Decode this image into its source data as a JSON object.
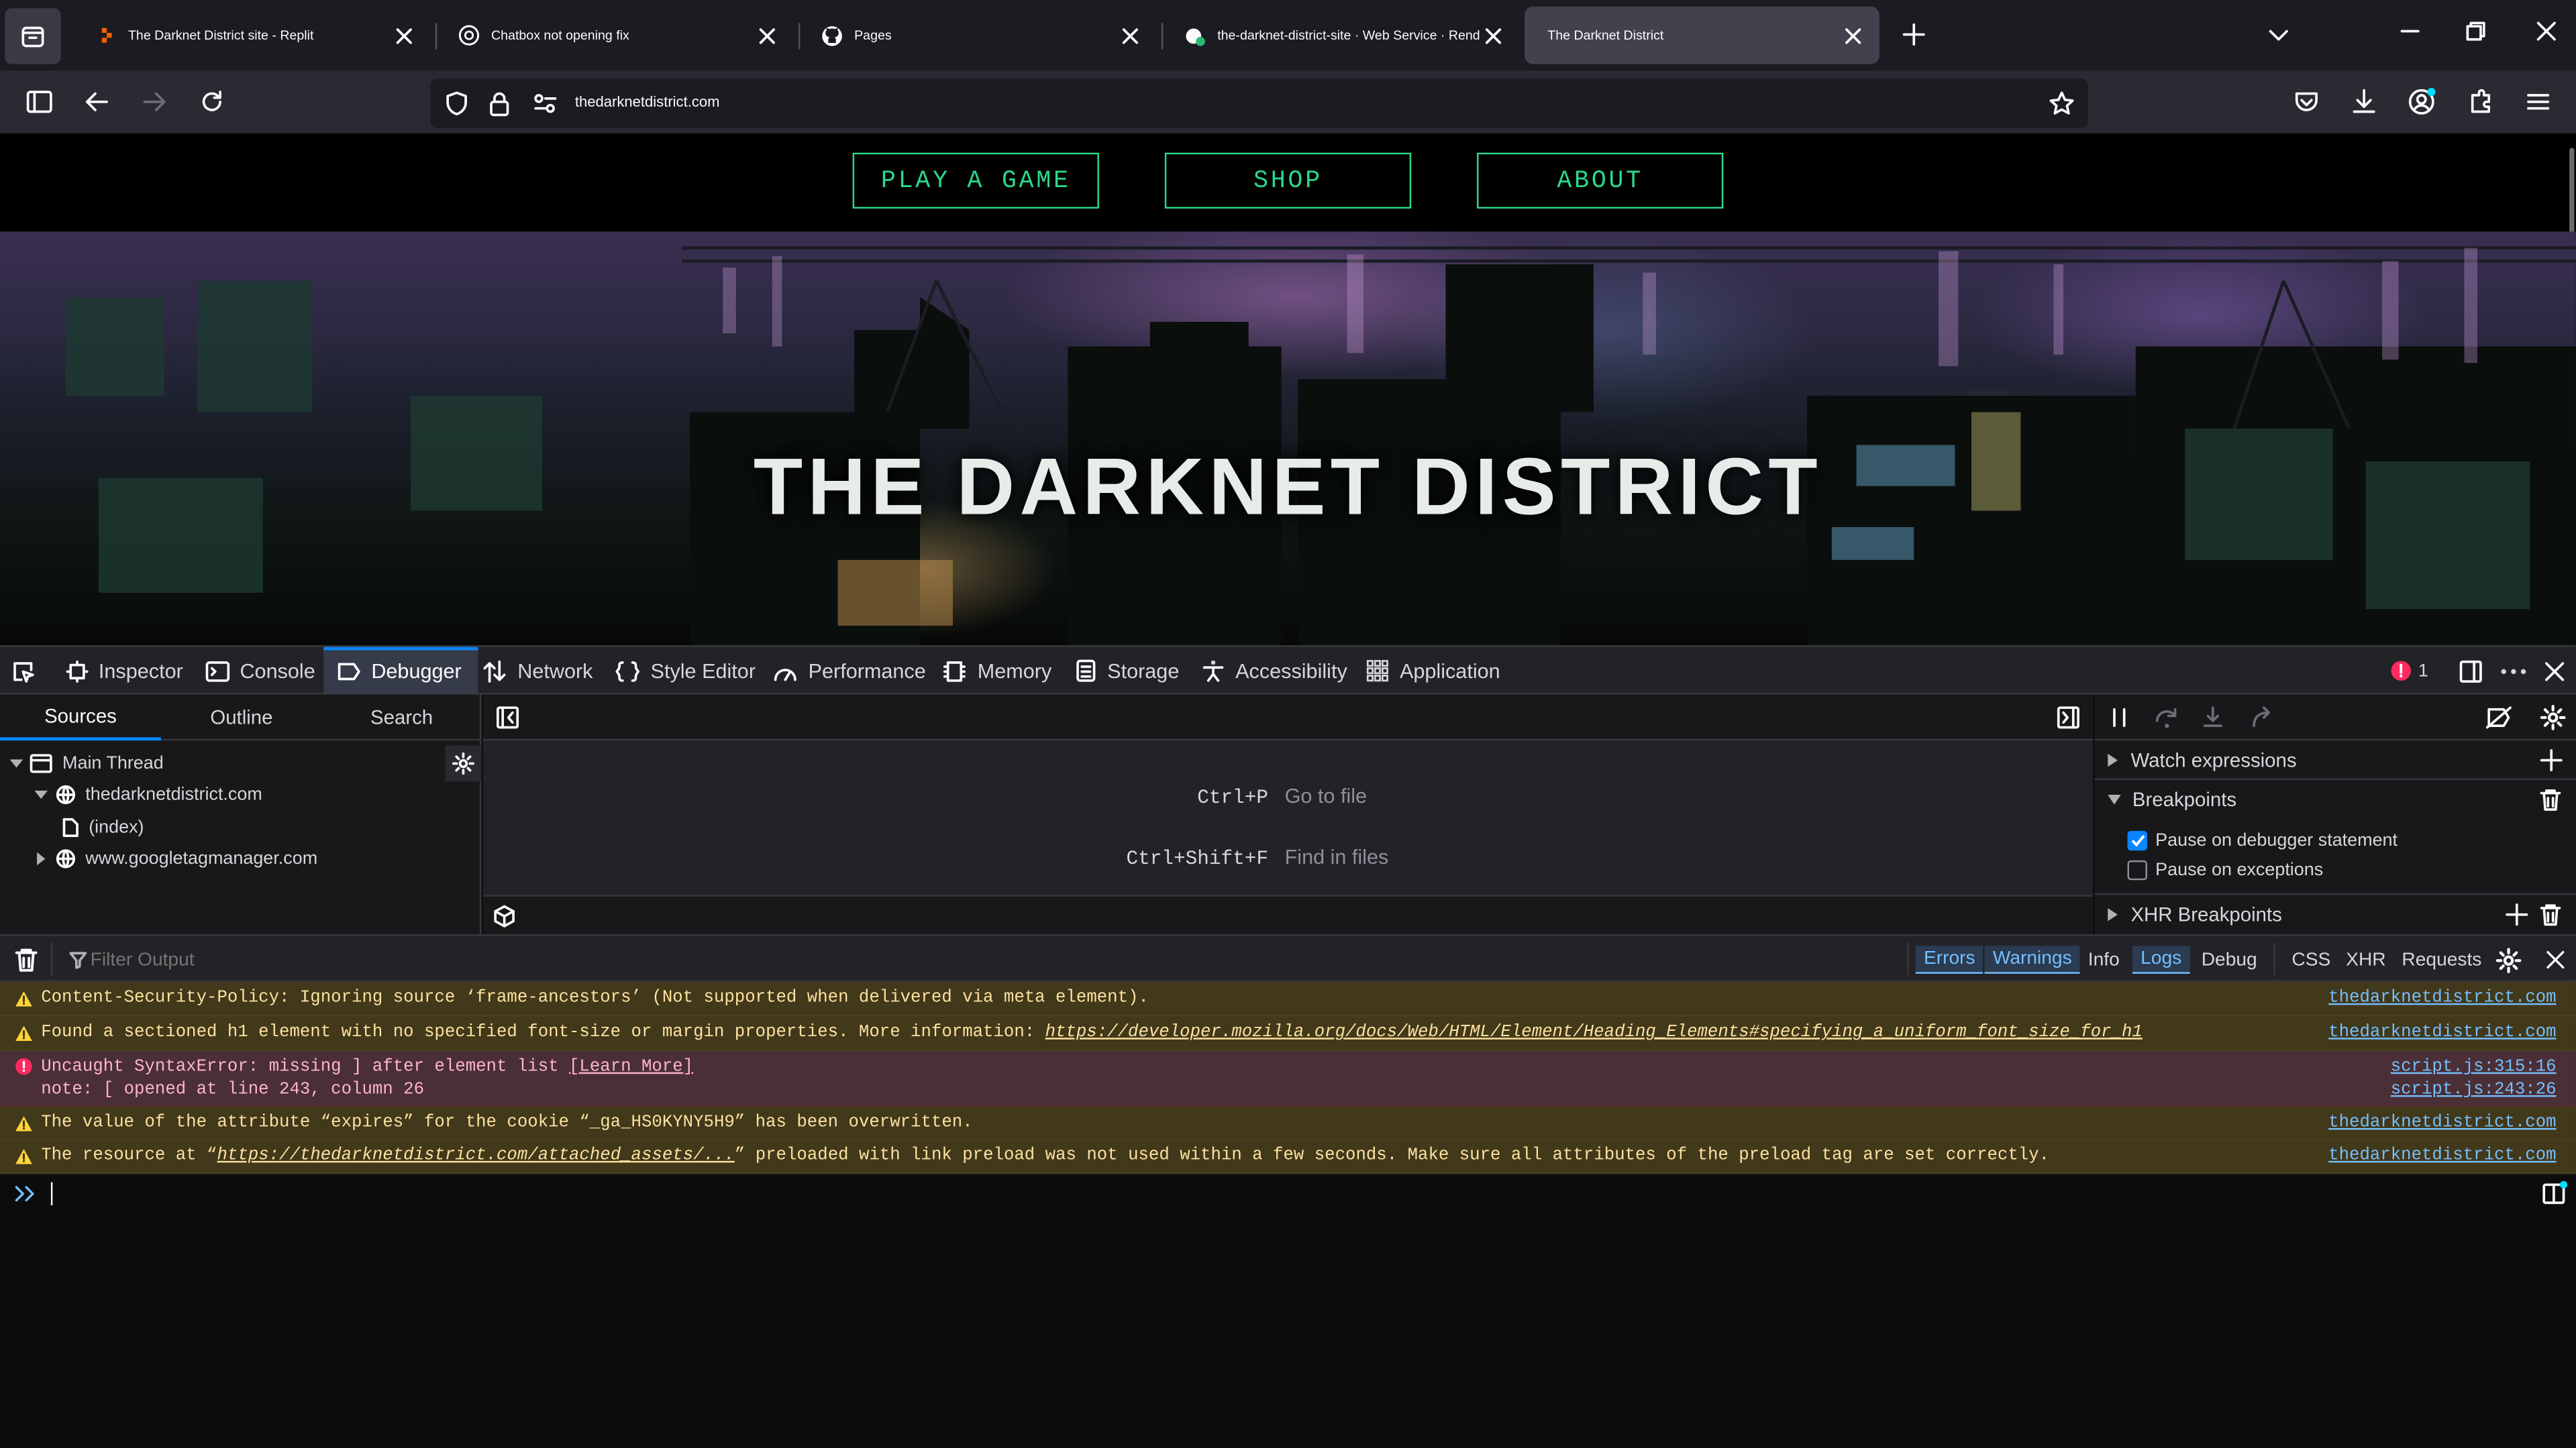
{
  "browser": {
    "tabs": [
      {
        "title": "The Darknet District site - Replit",
        "icon": "replit-icon"
      },
      {
        "title": "Chatbox not opening fix",
        "icon": "openai-icon"
      },
      {
        "title": "Pages",
        "icon": "github-icon"
      },
      {
        "title": "the-darknet-district-site · Web Service · Render",
        "icon": "render-icon"
      },
      {
        "title": "The Darknet District",
        "icon": "none",
        "active": true
      }
    ],
    "url": "thedarknetdistrict.com"
  },
  "page": {
    "nav": [
      "PLAY A GAME",
      "SHOP",
      "ABOUT"
    ],
    "hero_title": "THE DARKNET DISTRICT",
    "accent": "#2bd98a"
  },
  "devtools": {
    "tabs": [
      "Inspector",
      "Console",
      "Debugger",
      "Network",
      "Style Editor",
      "Performance",
      "Memory",
      "Storage",
      "Accessibility",
      "Application"
    ],
    "selected_tab": "Debugger",
    "error_count": "1",
    "sources_tabs": [
      "Sources",
      "Outline",
      "Search"
    ],
    "tree": [
      "Main Thread",
      "thedarknetdistrict.com",
      "(index)",
      "www.googletagmanager.com"
    ],
    "shortcuts": [
      {
        "keys": "Ctrl+P",
        "desc": "Go to file"
      },
      {
        "keys": "Ctrl+Shift+F",
        "desc": "Find in files"
      }
    ],
    "side": {
      "watch": "Watch expressions",
      "breakpoints": "Breakpoints",
      "pause_debugger": "Pause on debugger statement",
      "pause_exceptions": "Pause on exceptions",
      "xhr": "XHR Breakpoints"
    },
    "console": {
      "filter_placeholder": "Filter Output",
      "filters": [
        "Errors",
        "Warnings",
        "Info",
        "Logs",
        "Debug",
        "CSS",
        "XHR",
        "Requests"
      ],
      "messages": [
        {
          "level": "warn",
          "text": "Content-Security-Policy: Ignoring source ‘frame-ancestors’ (Not supported when delivered via meta element).",
          "source": "thedarknetdistrict.com"
        },
        {
          "level": "warn",
          "text": "Found a sectioned h1 element with no specified font-size or margin properties. More information: ",
          "link": "https://developer.mozilla.org/docs/Web/HTML/Element/Heading_Elements#specifying_a_uniform_font_size_for_h1",
          "source": "thedarknetdistrict.com"
        },
        {
          "level": "error",
          "text": "Uncaught SyntaxError: missing ] after element list ",
          "link": "[Learn More]",
          "note": "note: [ opened at line 243, column 26",
          "source": "script.js:315:16",
          "source2": "script.js:243:26"
        },
        {
          "level": "warn",
          "text": "The value of the attribute “expires” for the cookie “_ga_HS0KYNY5H9” has been overwritten.",
          "source": "thedarknetdistrict.com"
        },
        {
          "level": "warn",
          "text_pre": "The resource at “",
          "link": "https://thedarknetdistrict.com/attached_assets/...",
          "text_post": "” preloaded with link preload was not used within a few seconds. Make sure all attributes of the preload tag are set correctly.",
          "source": "thedarknetdistrict.com"
        }
      ]
    }
  }
}
